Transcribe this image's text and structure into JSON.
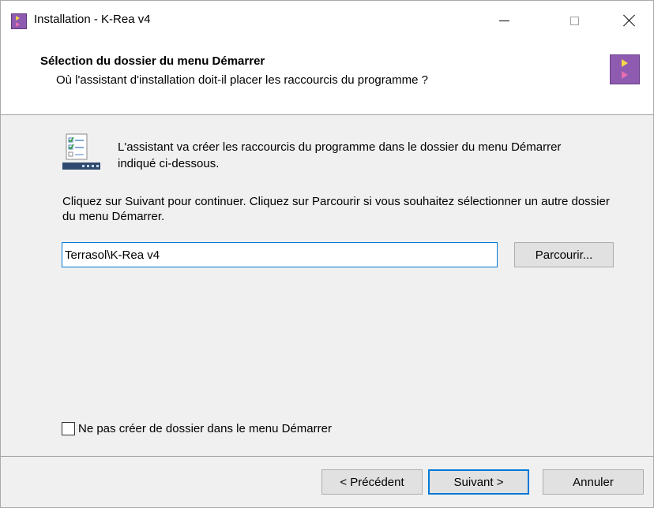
{
  "window": {
    "title": "Installation - K-Rea v4",
    "icon": "k-rea-installer-icon",
    "controls": {
      "minimize": "minimize-icon",
      "maximize": "maximize-icon",
      "close": "close-icon"
    }
  },
  "header": {
    "title": "Sélection du dossier du menu Démarrer",
    "subtitle": "Où l'assistant d'installation doit-il placer les raccourcis du programme ?",
    "icon": "wizard-icon"
  },
  "body": {
    "intro_icon": "start-menu-shortcut-icon",
    "intro_text": "L'assistant va créer les raccourcis du programme dans le dossier du menu Démarrer indiqué ci-dessous.",
    "instruction_text": "Cliquez sur Suivant pour continuer. Cliquez sur Parcourir si vous souhaitez sélectionner un autre dossier du menu Démarrer.",
    "folder_value": "Terrasol\\K-Rea v4",
    "browse_label": "Parcourir...",
    "no_folder_checkbox_label": "Ne pas créer de dossier dans le menu Démarrer",
    "no_folder_checked": false
  },
  "footer": {
    "back_label": "< Précédent",
    "next_label": "Suivant >",
    "cancel_label": "Annuler"
  },
  "colors": {
    "accent": "#0078d7",
    "brand": "#8e5bb0"
  }
}
